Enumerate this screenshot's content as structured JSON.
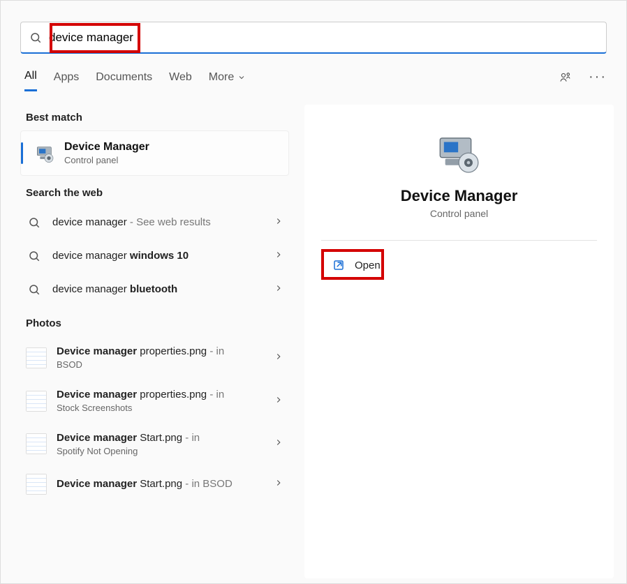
{
  "search": {
    "query": "device manager"
  },
  "tabs": {
    "all": "All",
    "apps": "Apps",
    "documents": "Documents",
    "web": "Web",
    "more": "More"
  },
  "left": {
    "best_match_header": "Best match",
    "best_match": {
      "title": "Device Manager",
      "subtitle": "Control panel"
    },
    "search_web_header": "Search the web",
    "web_items": [
      {
        "prefix": "device manager",
        "bold": "",
        "suffix": " - See web results"
      },
      {
        "prefix": "device manager ",
        "bold": "windows 10",
        "suffix": ""
      },
      {
        "prefix": "device manager ",
        "bold": "bluetooth",
        "suffix": ""
      }
    ],
    "photos_header": "Photos",
    "photo_items": [
      {
        "bold": "Device manager",
        "rest": " properties.png",
        "loc_label": " - in",
        "loc": "BSOD",
        "loc_inline": false
      },
      {
        "bold": "Device manager",
        "rest": " properties.png",
        "loc_label": " - in",
        "loc": "Stock Screenshots",
        "loc_inline": false
      },
      {
        "bold": "Device manager",
        "rest": " Start.png",
        "loc_label": " - in",
        "loc": "Spotify Not Opening",
        "loc_inline": false
      },
      {
        "bold": "Device manager",
        "rest": " Start.png",
        "loc_label": " - in ",
        "loc": "BSOD",
        "loc_inline": true
      }
    ]
  },
  "right": {
    "title": "Device Manager",
    "subtitle": "Control panel",
    "open_label": "Open"
  }
}
